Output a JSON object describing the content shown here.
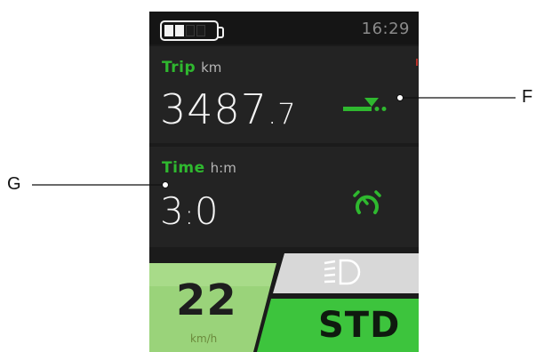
{
  "status_bar": {
    "battery": {
      "level_cells": 2,
      "total_cells": 5,
      "icon": "battery-icon"
    },
    "clock": "16:29"
  },
  "trip": {
    "label": "Trip",
    "unit": "km",
    "value_int": "3487",
    "value_dec": ".7",
    "icon": "trip-distance-icon"
  },
  "time": {
    "label": "Time",
    "unit": "h:m",
    "hours": "3",
    "sep": ":",
    "minutes": "0",
    "icon": "stopwatch-icon"
  },
  "speed": {
    "value": "22",
    "unit": "km/h"
  },
  "light": {
    "icon": "headlight-icon"
  },
  "mode": {
    "label": "STD"
  },
  "callouts": {
    "f": "F",
    "g": "G"
  },
  "colors": {
    "accent_green": "#2fb82f",
    "speed_panel_green": "#9ad37a",
    "mode_panel_green": "#3dc43d",
    "background": "#1b1b1b"
  }
}
